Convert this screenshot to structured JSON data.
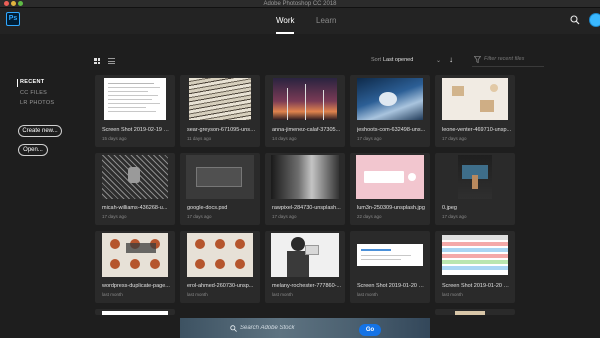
{
  "window": {
    "title": "Adobe Photoshop CC 2018"
  },
  "app": {
    "logo_text": "Ps",
    "icons": [
      "search-icon",
      "user-avatar"
    ]
  },
  "tabs": [
    {
      "label": "Work",
      "active": true
    },
    {
      "label": "Learn",
      "active": false
    }
  ],
  "sidebar": {
    "sections": [
      {
        "label": "RECENT",
        "active": true
      },
      {
        "label": "CC FILES"
      },
      {
        "label": "LR PHOTOS"
      }
    ],
    "buttons": [
      {
        "label": "Create new..."
      },
      {
        "label": "Open..."
      }
    ]
  },
  "toolbar": {
    "view_modes": [
      "grid-view-icon",
      "list-view-icon"
    ],
    "sort_label": "Sort",
    "sort_value": "Last opened",
    "filter_placeholder": "Filter recent files"
  },
  "recent_files": [
    {
      "name": "Screen Shot 2019-02-19 at ...",
      "date": "15 days ago",
      "thumb": "screenshot-doc"
    },
    {
      "name": "sear-greyson-671095-unsp...",
      "date": "11 days ago",
      "thumb": "books"
    },
    {
      "name": "anna-jimenez-calaf-37305...",
      "date": "14 days ago",
      "thumb": "windmills"
    },
    {
      "name": "jeshoots-com-632498-uns...",
      "date": "17 days ago",
      "thumb": "chess"
    },
    {
      "name": "leone-venter-469710-unsp...",
      "date": "17 days ago",
      "thumb": "wood-desk"
    },
    {
      "name": "micah-williams-436268-u...",
      "date": "17 days ago",
      "thumb": "lock-fence"
    },
    {
      "name": "google-docs.psd",
      "date": "17 days ago",
      "thumb": "google-docs"
    },
    {
      "name": "rawpixel-284730-unsplash...",
      "date": "17 days ago",
      "thumb": "meeting"
    },
    {
      "name": "lum3n-250309-unsplash.jpg",
      "date": "22 days ago",
      "thumb": "keyboard"
    },
    {
      "name": "0.jpeg",
      "date": "17 days ago",
      "thumb": "presenter"
    },
    {
      "name": "wordpress-duplicate-page...",
      "date": "last month",
      "thumb": "cookies-overlay"
    },
    {
      "name": "erol-ahmed-260730-unsp...",
      "date": "last month",
      "thumb": "cookies"
    },
    {
      "name": "melany-rochester-777860-...",
      "date": "last month",
      "thumb": "megaphone"
    },
    {
      "name": "Screen Shot 2019-01-20 at ...",
      "date": "last month",
      "thumb": "screenshot-small"
    },
    {
      "name": "Screen Shot 2019-01-20 at ...",
      "date": "last month",
      "thumb": "spreadsheet"
    }
  ],
  "stock": {
    "placeholder": "Search Adobe Stock",
    "button_label": "Go"
  },
  "colors": {
    "background": "#1e1e1e",
    "card": "#2a2a2a",
    "accent": "#31a8ff",
    "go_button": "#1473e6"
  }
}
